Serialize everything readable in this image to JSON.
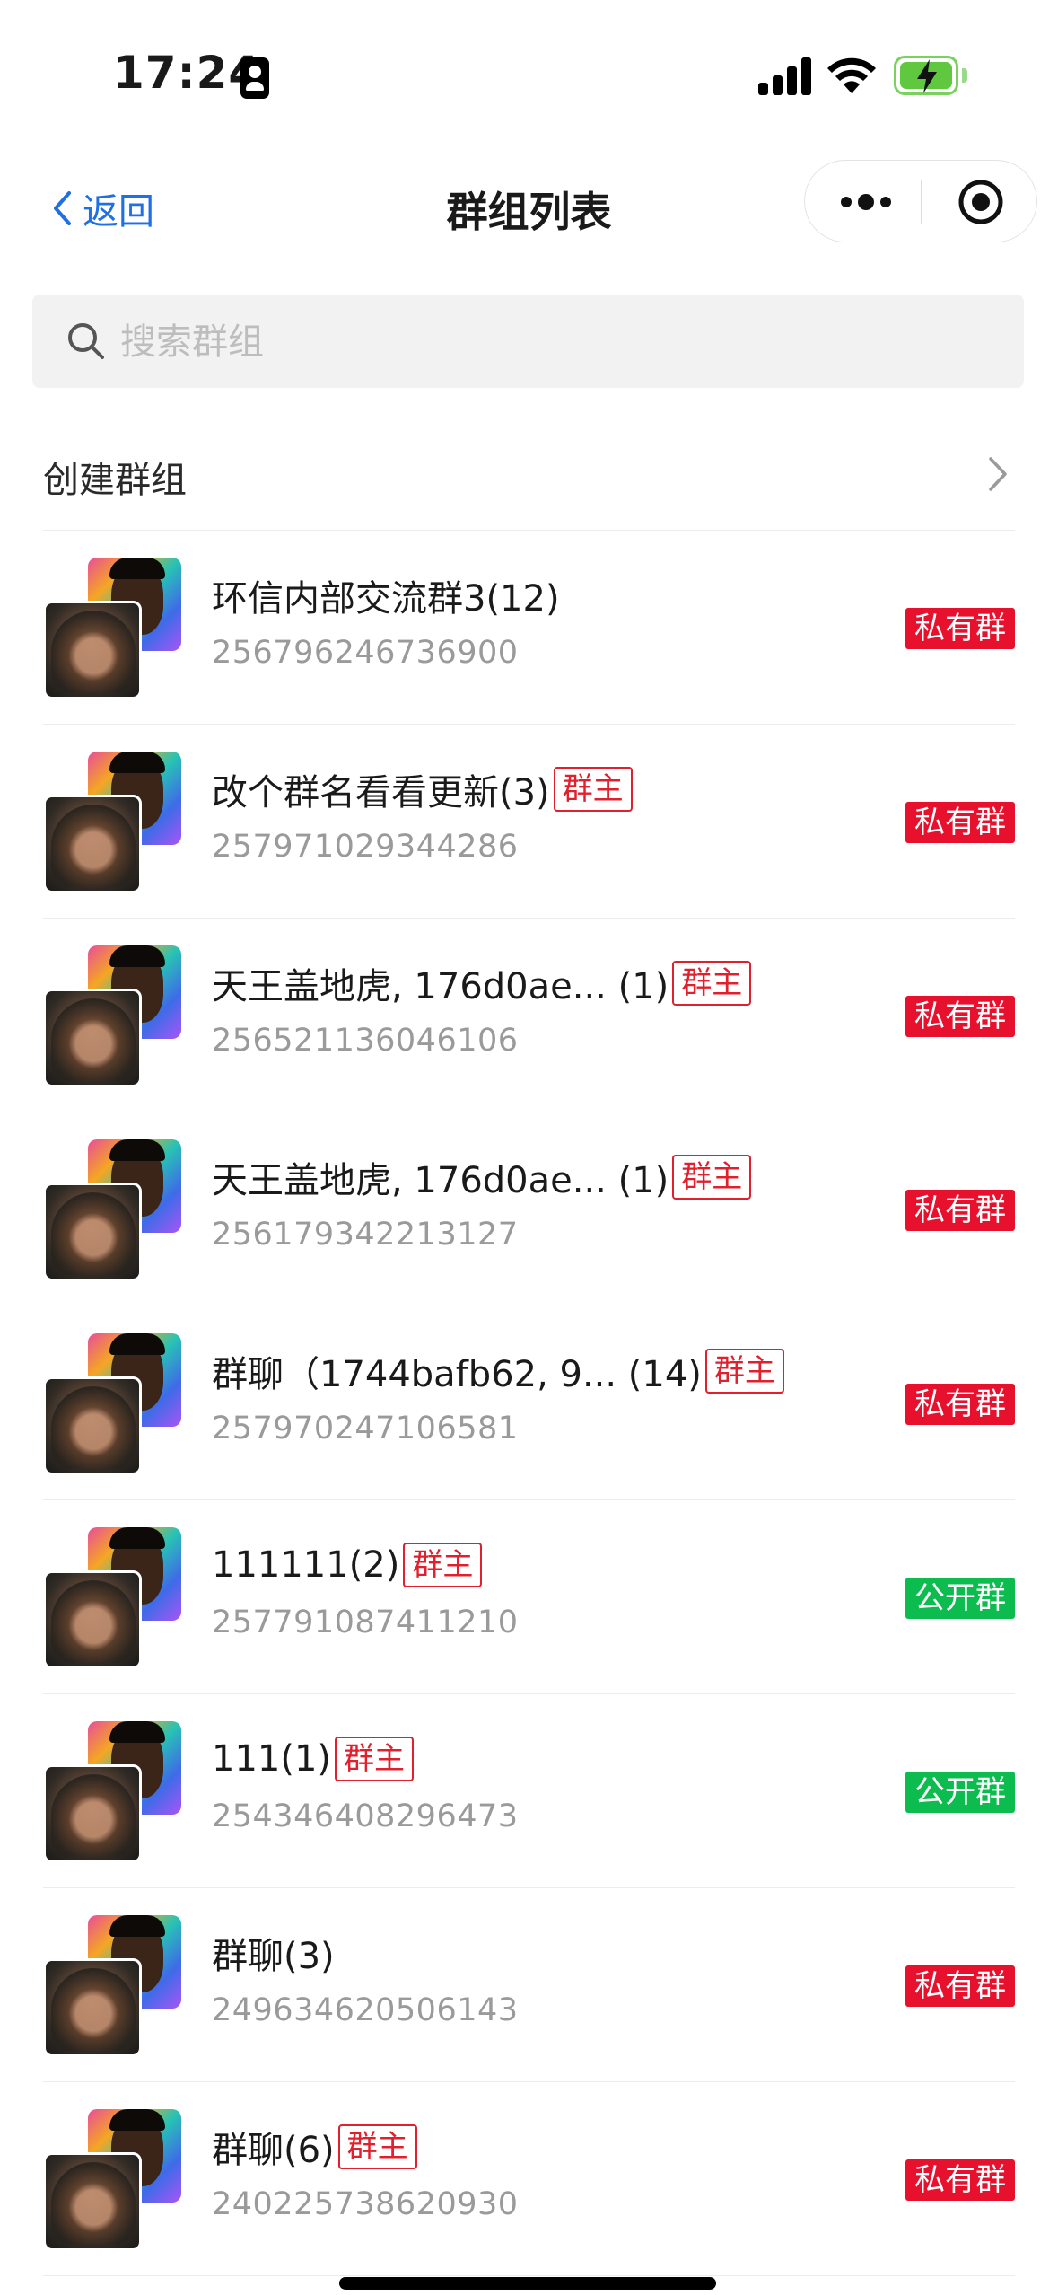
{
  "status_bar": {
    "time": "17:24"
  },
  "navbar": {
    "back_label": "返回",
    "title": "群组列表"
  },
  "search": {
    "placeholder": "搜索群组",
    "value": ""
  },
  "create": {
    "label": "创建群组"
  },
  "badges": {
    "owner": "群主"
  },
  "colors": {
    "accent": "#1f6fe5",
    "private_badge": "#e8112d",
    "public_badge": "#0dbc4f",
    "owner_badge": "#e0202c"
  },
  "groups": [
    {
      "name": "环信内部交流群3(12)",
      "owner": "",
      "id": "256796246736900",
      "type": "私有群",
      "kind": "private"
    },
    {
      "name": "改个群名看看更新(3)",
      "owner": "群主",
      "id": "257971029344286",
      "type": "私有群",
      "kind": "private"
    },
    {
      "name": "天王盖地虎, 176d0ae... (1)",
      "owner": "群主",
      "id": "256521136046106",
      "type": "私有群",
      "kind": "private"
    },
    {
      "name": "天王盖地虎, 176d0ae... (1)",
      "owner": "群主",
      "id": "256179342213127",
      "type": "私有群",
      "kind": "private"
    },
    {
      "name": "群聊（1744bafb62, 9... (14)",
      "owner": "群主",
      "id": "257970247106581",
      "type": "私有群",
      "kind": "private"
    },
    {
      "name": "111111(2)",
      "owner": "群主",
      "id": "257791087411210",
      "type": "公开群",
      "kind": "public"
    },
    {
      "name": "111(1)",
      "owner": "群主",
      "id": "254346408296473",
      "type": "公开群",
      "kind": "public"
    },
    {
      "name": "群聊(3)",
      "owner": "",
      "id": "249634620506143",
      "type": "私有群",
      "kind": "private"
    },
    {
      "name": "群聊(6)",
      "owner": "群主",
      "id": "240225738620930",
      "type": "私有群",
      "kind": "private"
    }
  ]
}
